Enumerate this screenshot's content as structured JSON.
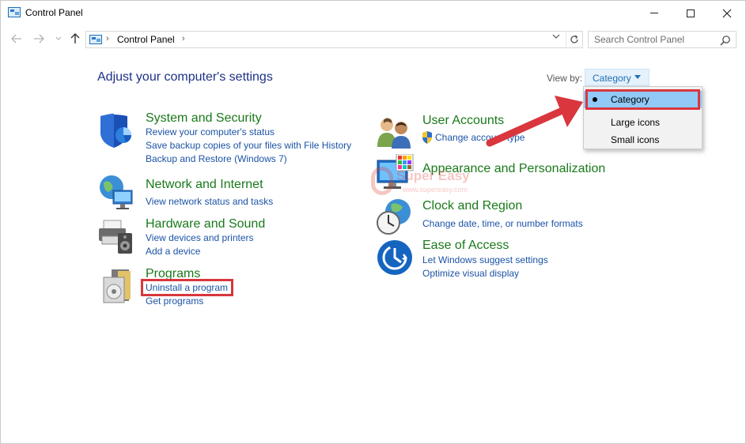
{
  "window": {
    "title": "Control Panel"
  },
  "address": {
    "path": "Control Panel",
    "search_placeholder": "Search Control Panel"
  },
  "content": {
    "heading": "Adjust your computer's settings",
    "view_by_label": "View by:",
    "view_by_value": "Category",
    "view_by_options": [
      "Category",
      "Large icons",
      "Small icons"
    ]
  },
  "categories": {
    "system": {
      "title": "System and Security",
      "links": [
        "Review your computer's status",
        "Save backup copies of your files with File History",
        "Backup and Restore (Windows 7)"
      ]
    },
    "network": {
      "title": "Network and Internet",
      "links": [
        "View network status and tasks"
      ]
    },
    "hardware": {
      "title": "Hardware and Sound",
      "links": [
        "View devices and printers",
        "Add a device"
      ]
    },
    "programs": {
      "title": "Programs",
      "links": [
        "Uninstall a program",
        "Get programs"
      ]
    },
    "users": {
      "title": "User Accounts",
      "links": [
        "Change account type"
      ]
    },
    "appearance": {
      "title": "Appearance and Personalization",
      "links": []
    },
    "clock": {
      "title": "Clock and Region",
      "links": [
        "Change date, time, or number formats"
      ]
    },
    "ease": {
      "title": "Ease of Access",
      "links": [
        "Let Windows suggest settings",
        "Optimize visual display"
      ]
    }
  },
  "watermark": {
    "text": "Super Easy",
    "url": "www.supereasy.com"
  },
  "colors": {
    "heading": "#1e3287",
    "category_title": "#197a1a",
    "link": "#1b53a6",
    "highlight": "#d9363e",
    "menu_selected": "#91c9f7"
  }
}
